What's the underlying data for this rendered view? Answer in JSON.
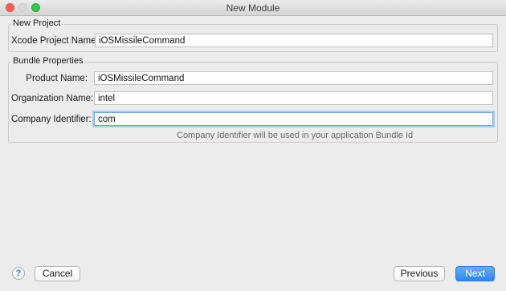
{
  "window": {
    "title": "New Module"
  },
  "new_project": {
    "legend": "New Project",
    "xcode_project_name": {
      "label": "Xcode Project Name:",
      "value": "iOSMissileCommand"
    }
  },
  "bundle_properties": {
    "legend": "Bundle Properties",
    "product_name": {
      "label": "Product Name:",
      "value": "iOSMissileCommand"
    },
    "organization_name": {
      "label": "Organization Name:",
      "value": "intel"
    },
    "company_identifier": {
      "label": "Company Identifier:",
      "value": "com"
    },
    "hint": "Company Identifier will be used in your application Bundle Id"
  },
  "footer": {
    "help_label": "?",
    "cancel_label": "Cancel",
    "previous_label": "Previous",
    "next_label": "Next"
  },
  "colors": {
    "primary_button": "#2c86ef",
    "focus_ring": "#6aa5e8",
    "close_light": "#fc5f57",
    "minimize_light": "#d9d9d9",
    "zoom_light": "#34c84a"
  }
}
